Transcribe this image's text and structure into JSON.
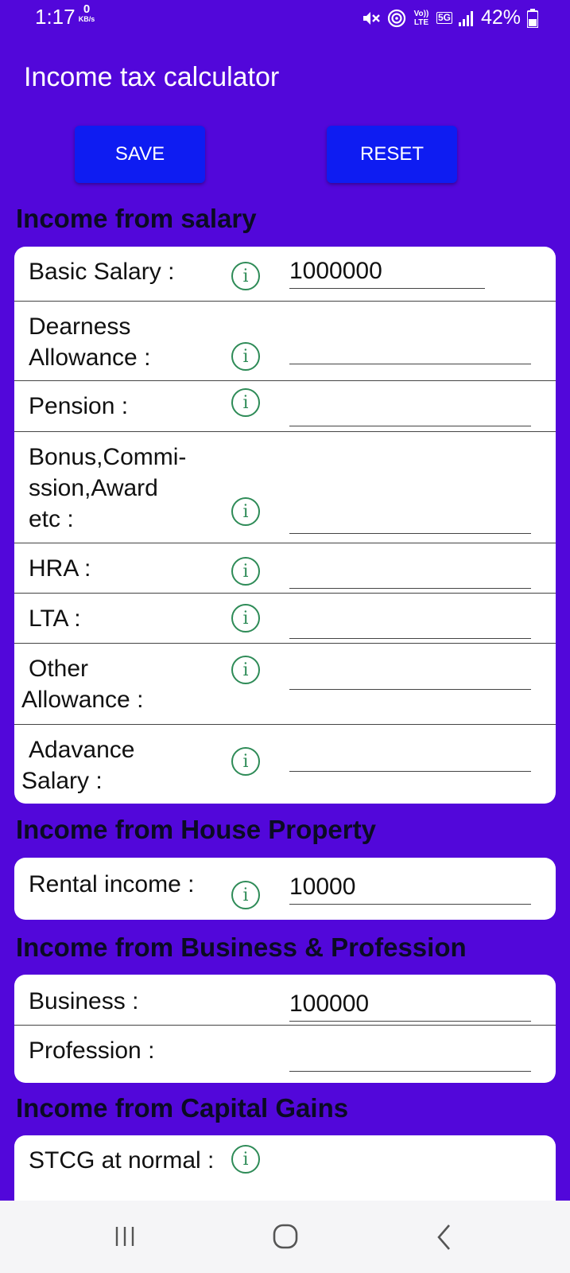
{
  "status_bar": {
    "time": "1:17",
    "net_speed_value": "0",
    "net_speed_unit": "KB/s",
    "volte": "Vo)) LTE",
    "network": "5G",
    "battery": "42%"
  },
  "app": {
    "title": "Income tax calculator"
  },
  "actions": {
    "save": "SAVE",
    "reset": "RESET"
  },
  "sections": {
    "salary": {
      "title": "Income from salary",
      "basic": "Basic Salary :",
      "basic_value": "1000000",
      "da_1": "Dearness",
      "da_2": "Allowance :",
      "pension": "Pension :",
      "bonus_1": "Bonus,Commi-",
      "bonus_2": "ssion,Award",
      "bonus_3": "etc :",
      "hra": "HRA :",
      "lta": "LTA :",
      "other_1": "Other",
      "other_2": "Allowance :",
      "adv_1": "Adavance",
      "adv_2": "Salary :"
    },
    "house": {
      "title": "Income from House Property",
      "rental": "Rental income :",
      "rental_value": "10000"
    },
    "business": {
      "title": "Income from Business & Profession",
      "business": "Business :",
      "business_value": "100000",
      "profession": "Profession :"
    },
    "capital": {
      "title": "Income from Capital Gains",
      "stcg": "STCG at normal :"
    }
  },
  "icons": {
    "info": "i",
    "info_icon_name": "info-circle-icon"
  },
  "colors": {
    "app_background": "#5207DA",
    "button": "#0E1CF2",
    "info_icon": "#2E8B57"
  }
}
